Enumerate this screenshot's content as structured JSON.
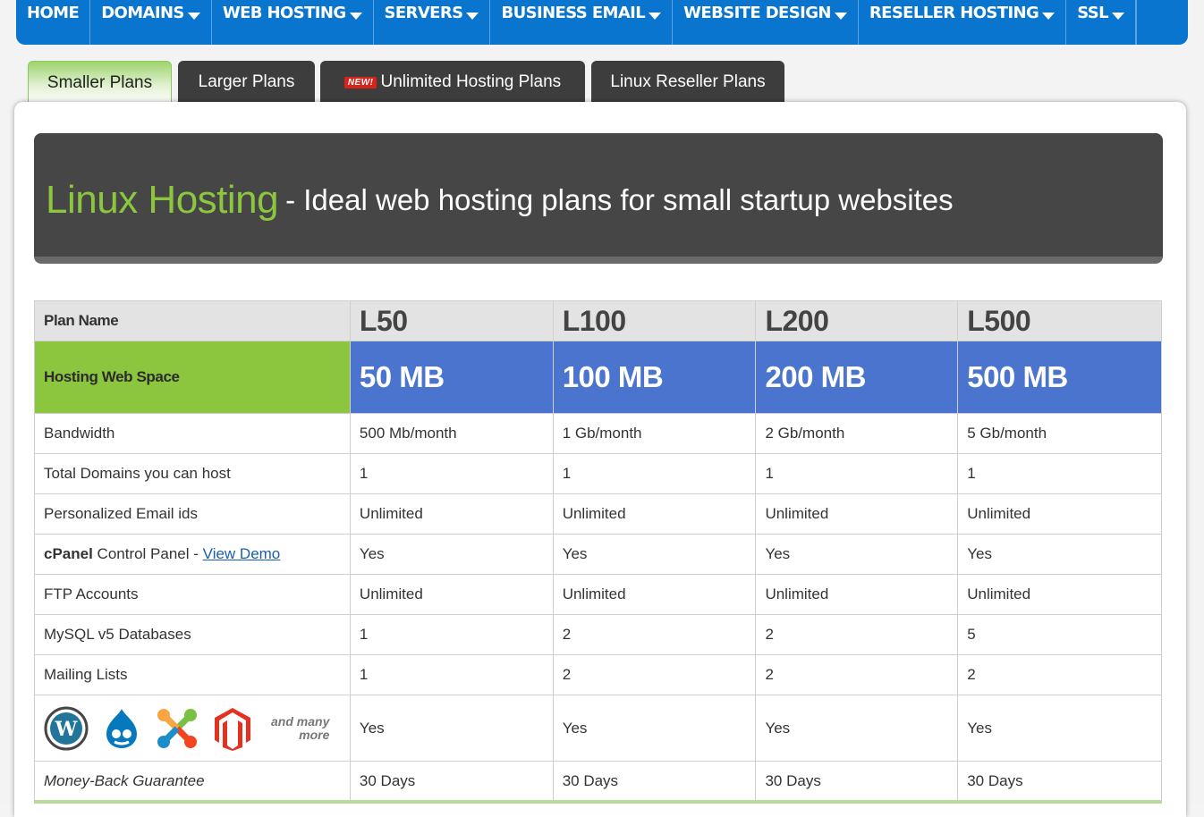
{
  "nav": {
    "items": [
      {
        "label": "HOME",
        "dropdown": false
      },
      {
        "label": "DOMAINS",
        "dropdown": true
      },
      {
        "label": "WEB HOSTING",
        "dropdown": true
      },
      {
        "label": "SERVERS",
        "dropdown": true
      },
      {
        "label": "BUSINESS EMAIL",
        "dropdown": true
      },
      {
        "label": "WEBSITE DESIGN",
        "dropdown": true
      },
      {
        "label": "RESELLER HOSTING",
        "dropdown": true
      },
      {
        "label": "SSL",
        "dropdown": true
      }
    ]
  },
  "tabs": [
    {
      "label": "Smaller Plans",
      "active": true
    },
    {
      "label": "Larger Plans",
      "active": false
    },
    {
      "label": "Unlimited Hosting Plans",
      "badge": "NEW!",
      "active": false
    },
    {
      "label": "Linux Reseller Plans",
      "active": false
    }
  ],
  "banner": {
    "title": "Linux Hosting",
    "subtitle": "- Ideal web hosting plans for small startup websites"
  },
  "table": {
    "header_label": "Plan Name",
    "plans": [
      "L50",
      "L100",
      "L200",
      "L500"
    ],
    "space_label": "Hosting Web Space",
    "space_values": [
      "50 MB",
      "100 MB",
      "200 MB",
      "500 MB"
    ],
    "rows": [
      {
        "label": "Bandwidth",
        "values": [
          "500 Mb/month",
          "1 Gb/month",
          "2 Gb/month",
          "5 Gb/month"
        ]
      },
      {
        "label": "Total Domains you can host",
        "values": [
          "1",
          "1",
          "1",
          "1"
        ]
      },
      {
        "label": "Personalized Email ids",
        "values": [
          "Unlimited",
          "Unlimited",
          "Unlimited",
          "Unlimited"
        ]
      },
      {
        "label_bold": "cPanel",
        "label_rest": " Control Panel - ",
        "link": "View Demo",
        "values": [
          "Yes",
          "Yes",
          "Yes",
          "Yes"
        ]
      },
      {
        "label": "FTP Accounts",
        "values": [
          "Unlimited",
          "Unlimited",
          "Unlimited",
          "Unlimited"
        ]
      },
      {
        "label": "MySQL v5 Databases",
        "values": [
          "1",
          "2",
          "2",
          "5"
        ]
      },
      {
        "label": "Mailing Lists",
        "values": [
          "1",
          "2",
          "2",
          "2"
        ]
      }
    ],
    "apps": {
      "icons": [
        "wordpress-icon",
        "drupal-icon",
        "joomla-icon",
        "magento-icon"
      ],
      "more_line1": "and many",
      "more_line2": "more",
      "values": [
        "Yes",
        "Yes",
        "Yes",
        "Yes"
      ]
    },
    "money_back": {
      "label": "Money-Back Guarantee",
      "values": [
        "30 Days",
        "30 Days",
        "30 Days",
        "30 Days"
      ]
    }
  },
  "colors": {
    "nav_blue": "#0a75cf",
    "brand_green": "#8cc63f",
    "space_blue": "#4a74cd",
    "banner_dark": "#464646"
  }
}
